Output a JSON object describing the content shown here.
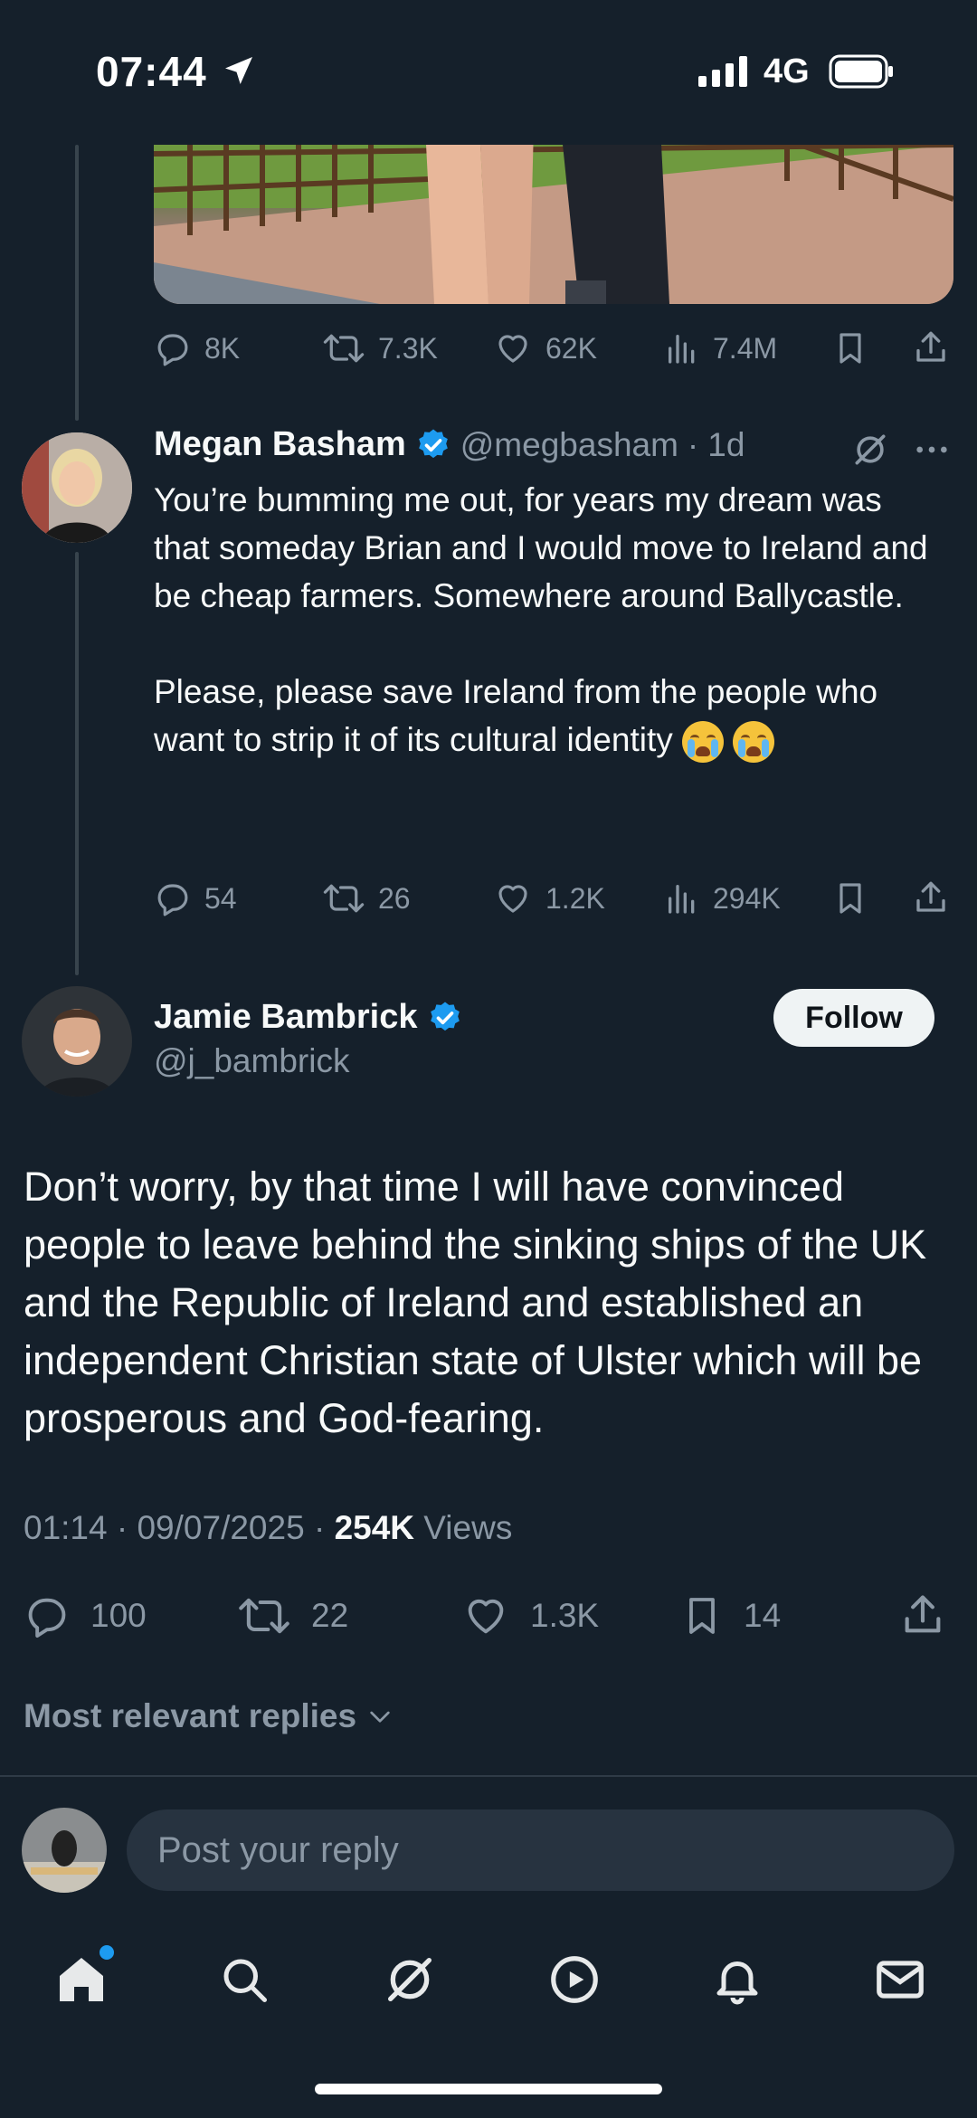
{
  "status_bar": {
    "time": "07:44",
    "network": "4G"
  },
  "parent_tweet_actions": {
    "replies": "8K",
    "reposts": "7.3K",
    "likes": "62K",
    "views": "7.4M"
  },
  "reply_tweet": {
    "name": "Megan Basham",
    "handle": "@megbasham",
    "separator": "·",
    "age": "1d",
    "text_p1": "You’re bumming me out, for years my dream was that someday Brian and I would move to Ireland and be cheap farmers. Somewhere around Ballycastle.",
    "text_p2": "Please, please save Ireland from the people who want to strip it of its cultural identity",
    "actions": {
      "replies": "54",
      "reposts": "26",
      "likes": "1.2K",
      "views": "294K"
    }
  },
  "main_tweet": {
    "name": "Jamie Bambrick",
    "handle": "@j_bambrick",
    "follow_label": "Follow",
    "text": "Don’t worry, by that time I will have convinced people to leave behind the sinking ships of the UK and the Republic of Ireland and established an independent Christian state of Ulster which will be prosperous and God-fearing.",
    "time": "01:14",
    "date": "09/07/2025",
    "separator": "·",
    "views_count": "254K",
    "views_label": "Views",
    "actions": {
      "replies": "100",
      "reposts": "22",
      "likes": "1.3K",
      "bookmarks": "14"
    }
  },
  "replies_sort": {
    "label": "Most relevant replies"
  },
  "composer": {
    "placeholder": "Post your reply"
  },
  "tab_bar": [
    "home-icon",
    "search-icon",
    "grok-icon",
    "video-icon",
    "notifications-icon",
    "messages-icon"
  ],
  "colors": {
    "background": "#15202b",
    "muted": "#8b98a5",
    "verified": "#1d9bf0",
    "text": "#f7f9f9"
  }
}
